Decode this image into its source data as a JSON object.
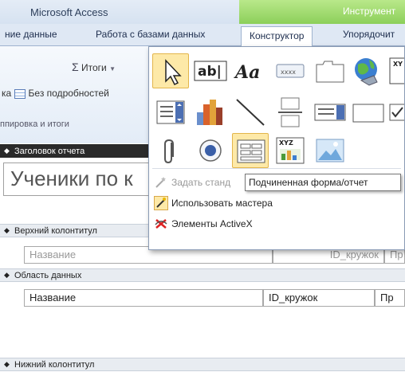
{
  "app_title": "Microsoft Access",
  "tool_context_label": "Инструмент",
  "tabs": [
    {
      "label": "ние данные"
    },
    {
      "label": "Работа с базами данных"
    },
    {
      "label": "Конструктор"
    },
    {
      "label": "Упорядочит"
    }
  ],
  "ribbon": {
    "totals_label": "Итоги",
    "details_prefix": "ка",
    "hide_details_label": "Без подробностей",
    "group_label": "ппировка и итоги"
  },
  "gallery": {
    "menu": [
      {
        "label": "Задать станд",
        "icon": "magic-wand-icon",
        "enabled": false
      },
      {
        "label": "Использовать мастера",
        "icon": "wizard-icon",
        "enabled": true
      },
      {
        "label": "Элементы ActiveX",
        "icon": "activex-icon",
        "enabled": true
      }
    ],
    "textbox_text": "ab|",
    "label_text": "Aa",
    "button_text": "xxxx",
    "chart_xyz_text": "XYZ",
    "corner_xy_text": "XY"
  },
  "tooltip": "Подчиненная форма/отчет",
  "report": {
    "header_band": "Заголовок отчета",
    "title_text": "Ученики по к",
    "page_header_band": "Верхний колонтитул",
    "detail_band": "Область данных",
    "page_footer_band": "Нижний колонтитул",
    "page_header_fields": [
      "Название",
      "ID_кружок",
      "Пр"
    ],
    "detail_fields": [
      "Название",
      "ID_кружок",
      "Пр"
    ]
  },
  "colors": {
    "tool_context": "#8ccf5a",
    "selected_control": "#fde9a8",
    "dark_band": "#2a2a2a"
  }
}
